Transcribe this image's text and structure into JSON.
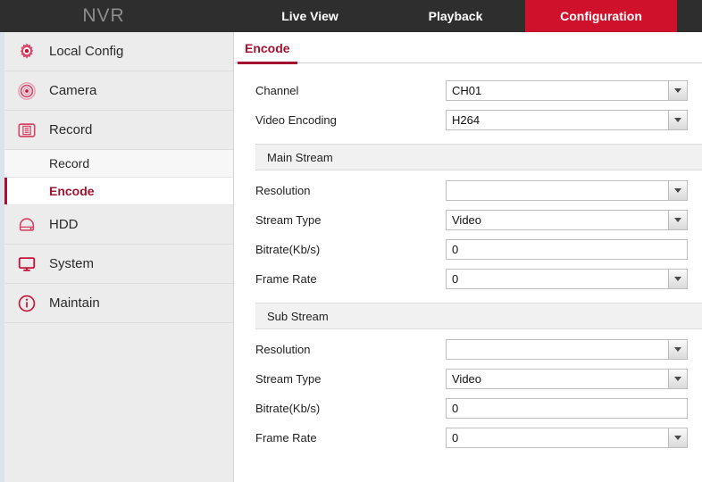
{
  "header": {
    "brand": "NVR",
    "tabs": [
      {
        "label": "Live View",
        "active": false
      },
      {
        "label": "Playback",
        "active": false
      },
      {
        "label": "Configuration",
        "active": true
      }
    ],
    "active_tab_color": "#d0112b"
  },
  "sidebar": {
    "items": [
      {
        "label": "Local Config",
        "icon": "gear-icon"
      },
      {
        "label": "Camera",
        "icon": "camera-lens-icon"
      },
      {
        "label": "Record",
        "icon": "record-film-icon"
      }
    ],
    "subitems": [
      {
        "label": "Record",
        "active": false
      },
      {
        "label": "Encode",
        "active": true
      }
    ],
    "items_after": [
      {
        "label": "HDD",
        "icon": "hard-drive-icon"
      },
      {
        "label": "System",
        "icon": "monitor-icon"
      },
      {
        "label": "Maintain",
        "icon": "info-circle-icon"
      }
    ],
    "accent_color": "#a51230",
    "icon_color": "#d6486a"
  },
  "content": {
    "tab": {
      "label": "Encode",
      "underline_color": "#a51230"
    },
    "top_fields": [
      {
        "label": "Channel",
        "value": "CH01",
        "type": "select"
      },
      {
        "label": "Video Encoding",
        "value": "H264",
        "type": "select"
      }
    ],
    "sections": [
      {
        "title": "Main Stream",
        "fields": [
          {
            "label": "Resolution",
            "value": "",
            "type": "select"
          },
          {
            "label": "Stream Type",
            "value": "Video",
            "type": "select"
          },
          {
            "label": "Bitrate(Kb/s)",
            "value": "0",
            "type": "text"
          },
          {
            "label": "Frame Rate",
            "value": "0",
            "type": "select"
          }
        ]
      },
      {
        "title": "Sub Stream",
        "fields": [
          {
            "label": "Resolution",
            "value": "",
            "type": "select"
          },
          {
            "label": "Stream Type",
            "value": "Video",
            "type": "select"
          },
          {
            "label": "Bitrate(Kb/s)",
            "value": "0",
            "type": "text"
          },
          {
            "label": "Frame Rate",
            "value": "0",
            "type": "select"
          }
        ]
      }
    ]
  }
}
